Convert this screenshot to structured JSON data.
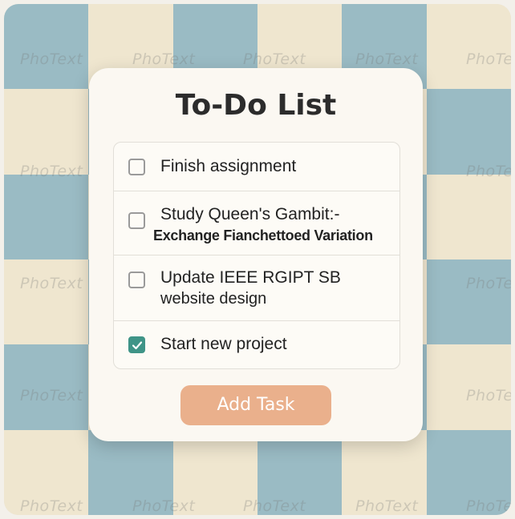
{
  "app": {
    "title": "To-Do List",
    "watermark": "PhoText"
  },
  "tasks": [
    {
      "text": "Finish assignment",
      "subtext": "",
      "checked": false
    },
    {
      "text": "Study Queen's Gambit:-",
      "subtext": "Exchange Fianchettoed Variation",
      "checked": false
    },
    {
      "text": "Update IEEE RGIPT SB",
      "subtext": "website design",
      "checked": false
    },
    {
      "text": "Start new project",
      "subtext": "",
      "checked": true
    }
  ],
  "actions": {
    "add_label": "Add Task"
  },
  "colors": {
    "accent_checked": "#3f9487",
    "add_button": "#eab08c",
    "card": "#fbf8f2",
    "checker_dark": "#8cb4c2",
    "checker_light": "#efe6cf"
  },
  "icons": {
    "checkbox_checked": "checkmark-icon"
  }
}
